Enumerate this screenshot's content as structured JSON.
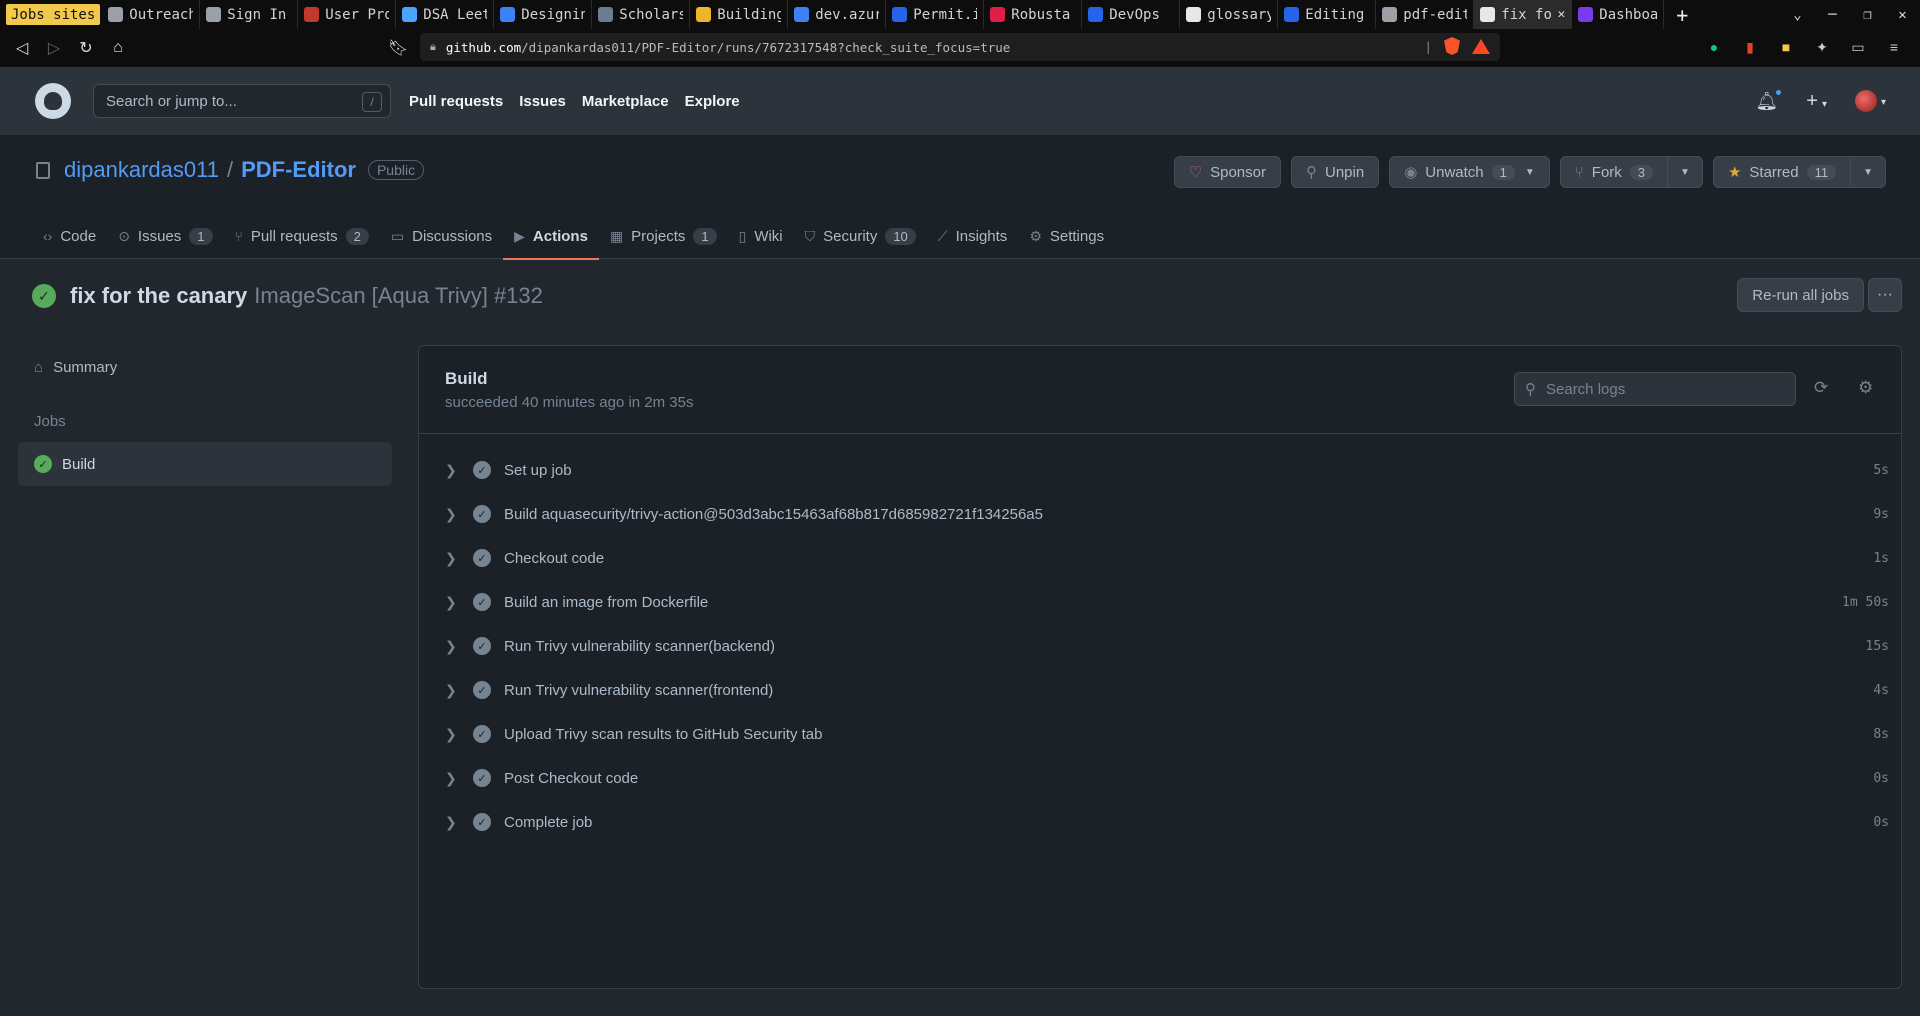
{
  "browser": {
    "tabs": [
      {
        "label": "Jobs sites",
        "color": "#f2c94c",
        "style": "highlight"
      },
      {
        "label": "Outreach",
        "color": "#9aa0a6"
      },
      {
        "label": "Sign In",
        "color": "#9aa0a6"
      },
      {
        "label": "User Pro",
        "color": "#c0392b"
      },
      {
        "label": "DSA Leet",
        "color": "#4aa3ff"
      },
      {
        "label": "Designin",
        "color": "#3b82f6"
      },
      {
        "label": "Scholars",
        "color": "#6b7c93"
      },
      {
        "label": "Building",
        "color": "#f0b429"
      },
      {
        "label": "dev.azur",
        "color": "#3b82f6"
      },
      {
        "label": "Permit.i",
        "color": "#2563eb"
      },
      {
        "label": "Robusta",
        "color": "#e11d48"
      },
      {
        "label": "DevOps",
        "color": "#2563eb"
      },
      {
        "label": "glossary",
        "color": "#e5e7eb"
      },
      {
        "label": "Editing",
        "color": "#2563eb"
      },
      {
        "label": "pdf-edit",
        "color": "#9aa0a6"
      },
      {
        "label": "fix fo",
        "color": "#e5e7eb",
        "style": "active"
      },
      {
        "label": "Dashboar",
        "color": "#7c3aed"
      }
    ],
    "url_host": "github.com",
    "url_path": "/dipankardas011/PDF-Editor/runs/7672317548?check_suite_focus=true"
  },
  "header": {
    "search_placeholder": "Search or jump to...",
    "search_key": "/",
    "nav": [
      "Pull requests",
      "Issues",
      "Marketplace",
      "Explore"
    ]
  },
  "repo": {
    "owner": "dipankardas011",
    "name": "PDF-Editor",
    "visibility": "Public",
    "actions": {
      "sponsor": "Sponsor",
      "unpin": "Unpin",
      "unwatch": "Unwatch",
      "unwatch_count": "1",
      "fork": "Fork",
      "fork_count": "3",
      "starred": "Starred",
      "star_count": "11"
    },
    "tabs": [
      {
        "label": "Code",
        "icon": "code-icon",
        "glyph": "‹›",
        "count": ""
      },
      {
        "label": "Issues",
        "icon": "issue-icon",
        "glyph": "⊙",
        "count": "1"
      },
      {
        "label": "Pull requests",
        "icon": "pull-request-icon",
        "glyph": "⑂",
        "count": "2"
      },
      {
        "label": "Discussions",
        "icon": "discussion-icon",
        "glyph": "▭",
        "count": ""
      },
      {
        "label": "Actions",
        "icon": "play-icon",
        "glyph": "▶",
        "count": "",
        "active": true
      },
      {
        "label": "Projects",
        "icon": "table-icon",
        "glyph": "▦",
        "count": "1"
      },
      {
        "label": "Wiki",
        "icon": "book-icon",
        "glyph": "▯",
        "count": ""
      },
      {
        "label": "Security",
        "icon": "shield-icon",
        "glyph": "⛉",
        "count": "10"
      },
      {
        "label": "Insights",
        "icon": "graph-icon",
        "glyph": "⟋",
        "count": ""
      },
      {
        "label": "Settings",
        "icon": "gear-icon",
        "glyph": "⚙",
        "count": ""
      }
    ]
  },
  "run": {
    "title": "fix for the canary",
    "workflow": "ImageScan [Aqua Trivy] #132",
    "rerun_label": "Re-run all jobs",
    "more": "···"
  },
  "sidebar": {
    "summary": "Summary",
    "jobs_heading": "Jobs",
    "jobs": [
      {
        "label": "Build",
        "status": "success"
      }
    ]
  },
  "job": {
    "title": "Build",
    "subtitle": "succeeded 40 minutes ago in 2m 35s",
    "search_placeholder": "Search logs",
    "steps": [
      {
        "name": "Set up job",
        "duration": "5s"
      },
      {
        "name": "Build aquasecurity/trivy-action@503d3abc15463af68b817d685982721f134256a5",
        "duration": "9s"
      },
      {
        "name": "Checkout code",
        "duration": "1s"
      },
      {
        "name": "Build an image from Dockerfile",
        "duration": "1m 50s"
      },
      {
        "name": "Run Trivy vulnerability scanner(backend)",
        "duration": "15s"
      },
      {
        "name": "Run Trivy vulnerability scanner(frontend)",
        "duration": "4s"
      },
      {
        "name": "Upload Trivy scan results to GitHub Security tab",
        "duration": "8s"
      },
      {
        "name": "Post Checkout code",
        "duration": "0s"
      },
      {
        "name": "Complete job",
        "duration": "0s"
      }
    ]
  }
}
